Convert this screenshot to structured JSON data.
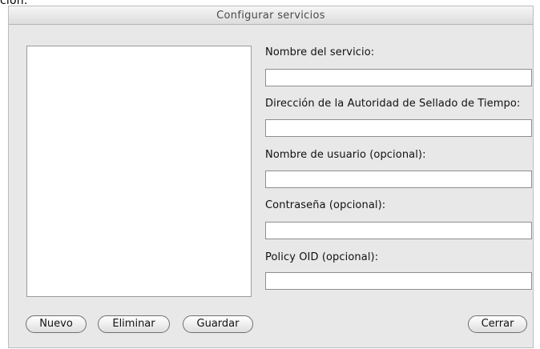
{
  "background_text": "ción.",
  "dialog": {
    "title": "Configurar servicios"
  },
  "form": {
    "service_name_label": "Nombre del servicio:",
    "service_name_value": "",
    "tsa_address_label": "Dirección de la Autoridad de Sellado de Tiempo:",
    "tsa_address_value": "",
    "username_label": "Nombre de usuario (opcional):",
    "username_value": "",
    "password_label": "Contraseña (opcional):",
    "password_value": "",
    "policy_oid_label": "Policy OID (opcional):",
    "policy_oid_value": ""
  },
  "buttons": {
    "new": "Nuevo",
    "delete": "Eliminar",
    "save": "Guardar",
    "close": "Cerrar"
  },
  "colors": {
    "dialog_background": "#e8e8e8",
    "list_background": "#ffffff",
    "title_text": "#4a4a4a"
  }
}
